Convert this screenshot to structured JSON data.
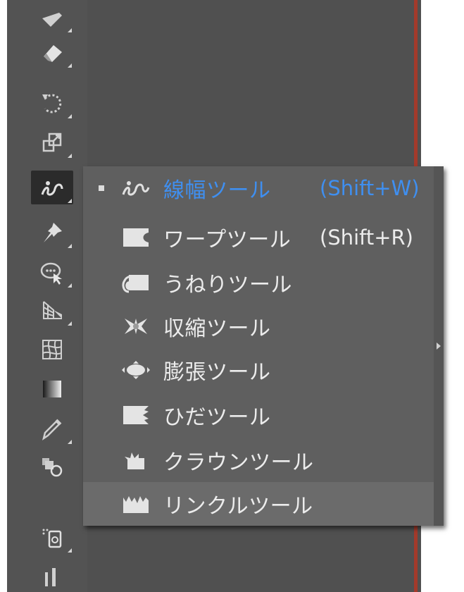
{
  "toolbar": {
    "tools": [
      {
        "name": "pencil-tool",
        "icon": "pencil-icon"
      },
      {
        "name": "eraser-tool",
        "icon": "eraser-icon"
      },
      {
        "name": "rotate-tool",
        "icon": "rotate-icon"
      },
      {
        "name": "scale-tool",
        "icon": "scale-icon"
      },
      {
        "name": "width-tool",
        "icon": "twirl-icon",
        "active": true
      },
      {
        "name": "puppet-warp-tool",
        "icon": "pin-icon"
      },
      {
        "name": "shape-builder-tool",
        "icon": "shape-builder-icon"
      },
      {
        "name": "perspective-grid-tool",
        "icon": "perspective-grid-icon"
      },
      {
        "name": "mesh-tool",
        "icon": "mesh-icon"
      },
      {
        "name": "gradient-tool",
        "icon": "gradient-icon"
      },
      {
        "name": "eyedropper-tool",
        "icon": "eyedropper-icon"
      },
      {
        "name": "blend-tool",
        "icon": "blend-icon"
      },
      {
        "name": "symbol-sprayer-tool",
        "icon": "symbol-sprayer-icon"
      },
      {
        "name": "graph-tool",
        "icon": "column-graph-icon"
      }
    ]
  },
  "flyout": {
    "items": [
      {
        "label": "線幅ツール",
        "shortcut": "(Shift+W)",
        "icon": "width-tool-icon",
        "selected": true
      },
      {
        "label": "ワープツール",
        "shortcut": "(Shift+R)",
        "icon": "warp-tool-icon"
      },
      {
        "label": "うねりツール",
        "shortcut": "",
        "icon": "twirl-tool-icon"
      },
      {
        "label": "収縮ツール",
        "shortcut": "",
        "icon": "pucker-tool-icon"
      },
      {
        "label": "膨張ツール",
        "shortcut": "",
        "icon": "bloat-tool-icon"
      },
      {
        "label": "ひだツール",
        "shortcut": "",
        "icon": "scallop-tool-icon"
      },
      {
        "label": "クラウンツール",
        "shortcut": "",
        "icon": "crystallize-tool-icon"
      },
      {
        "label": "リンクルツール",
        "shortcut": "",
        "icon": "wrinkle-tool-icon",
        "hovered": true
      }
    ]
  },
  "colors": {
    "toolbar_bg": "#535353",
    "canvas_bg": "#505050",
    "menu_bg": "#5f5f5f",
    "selected_text": "#3f8ff0",
    "artboard_edge": "#a33a2b"
  }
}
